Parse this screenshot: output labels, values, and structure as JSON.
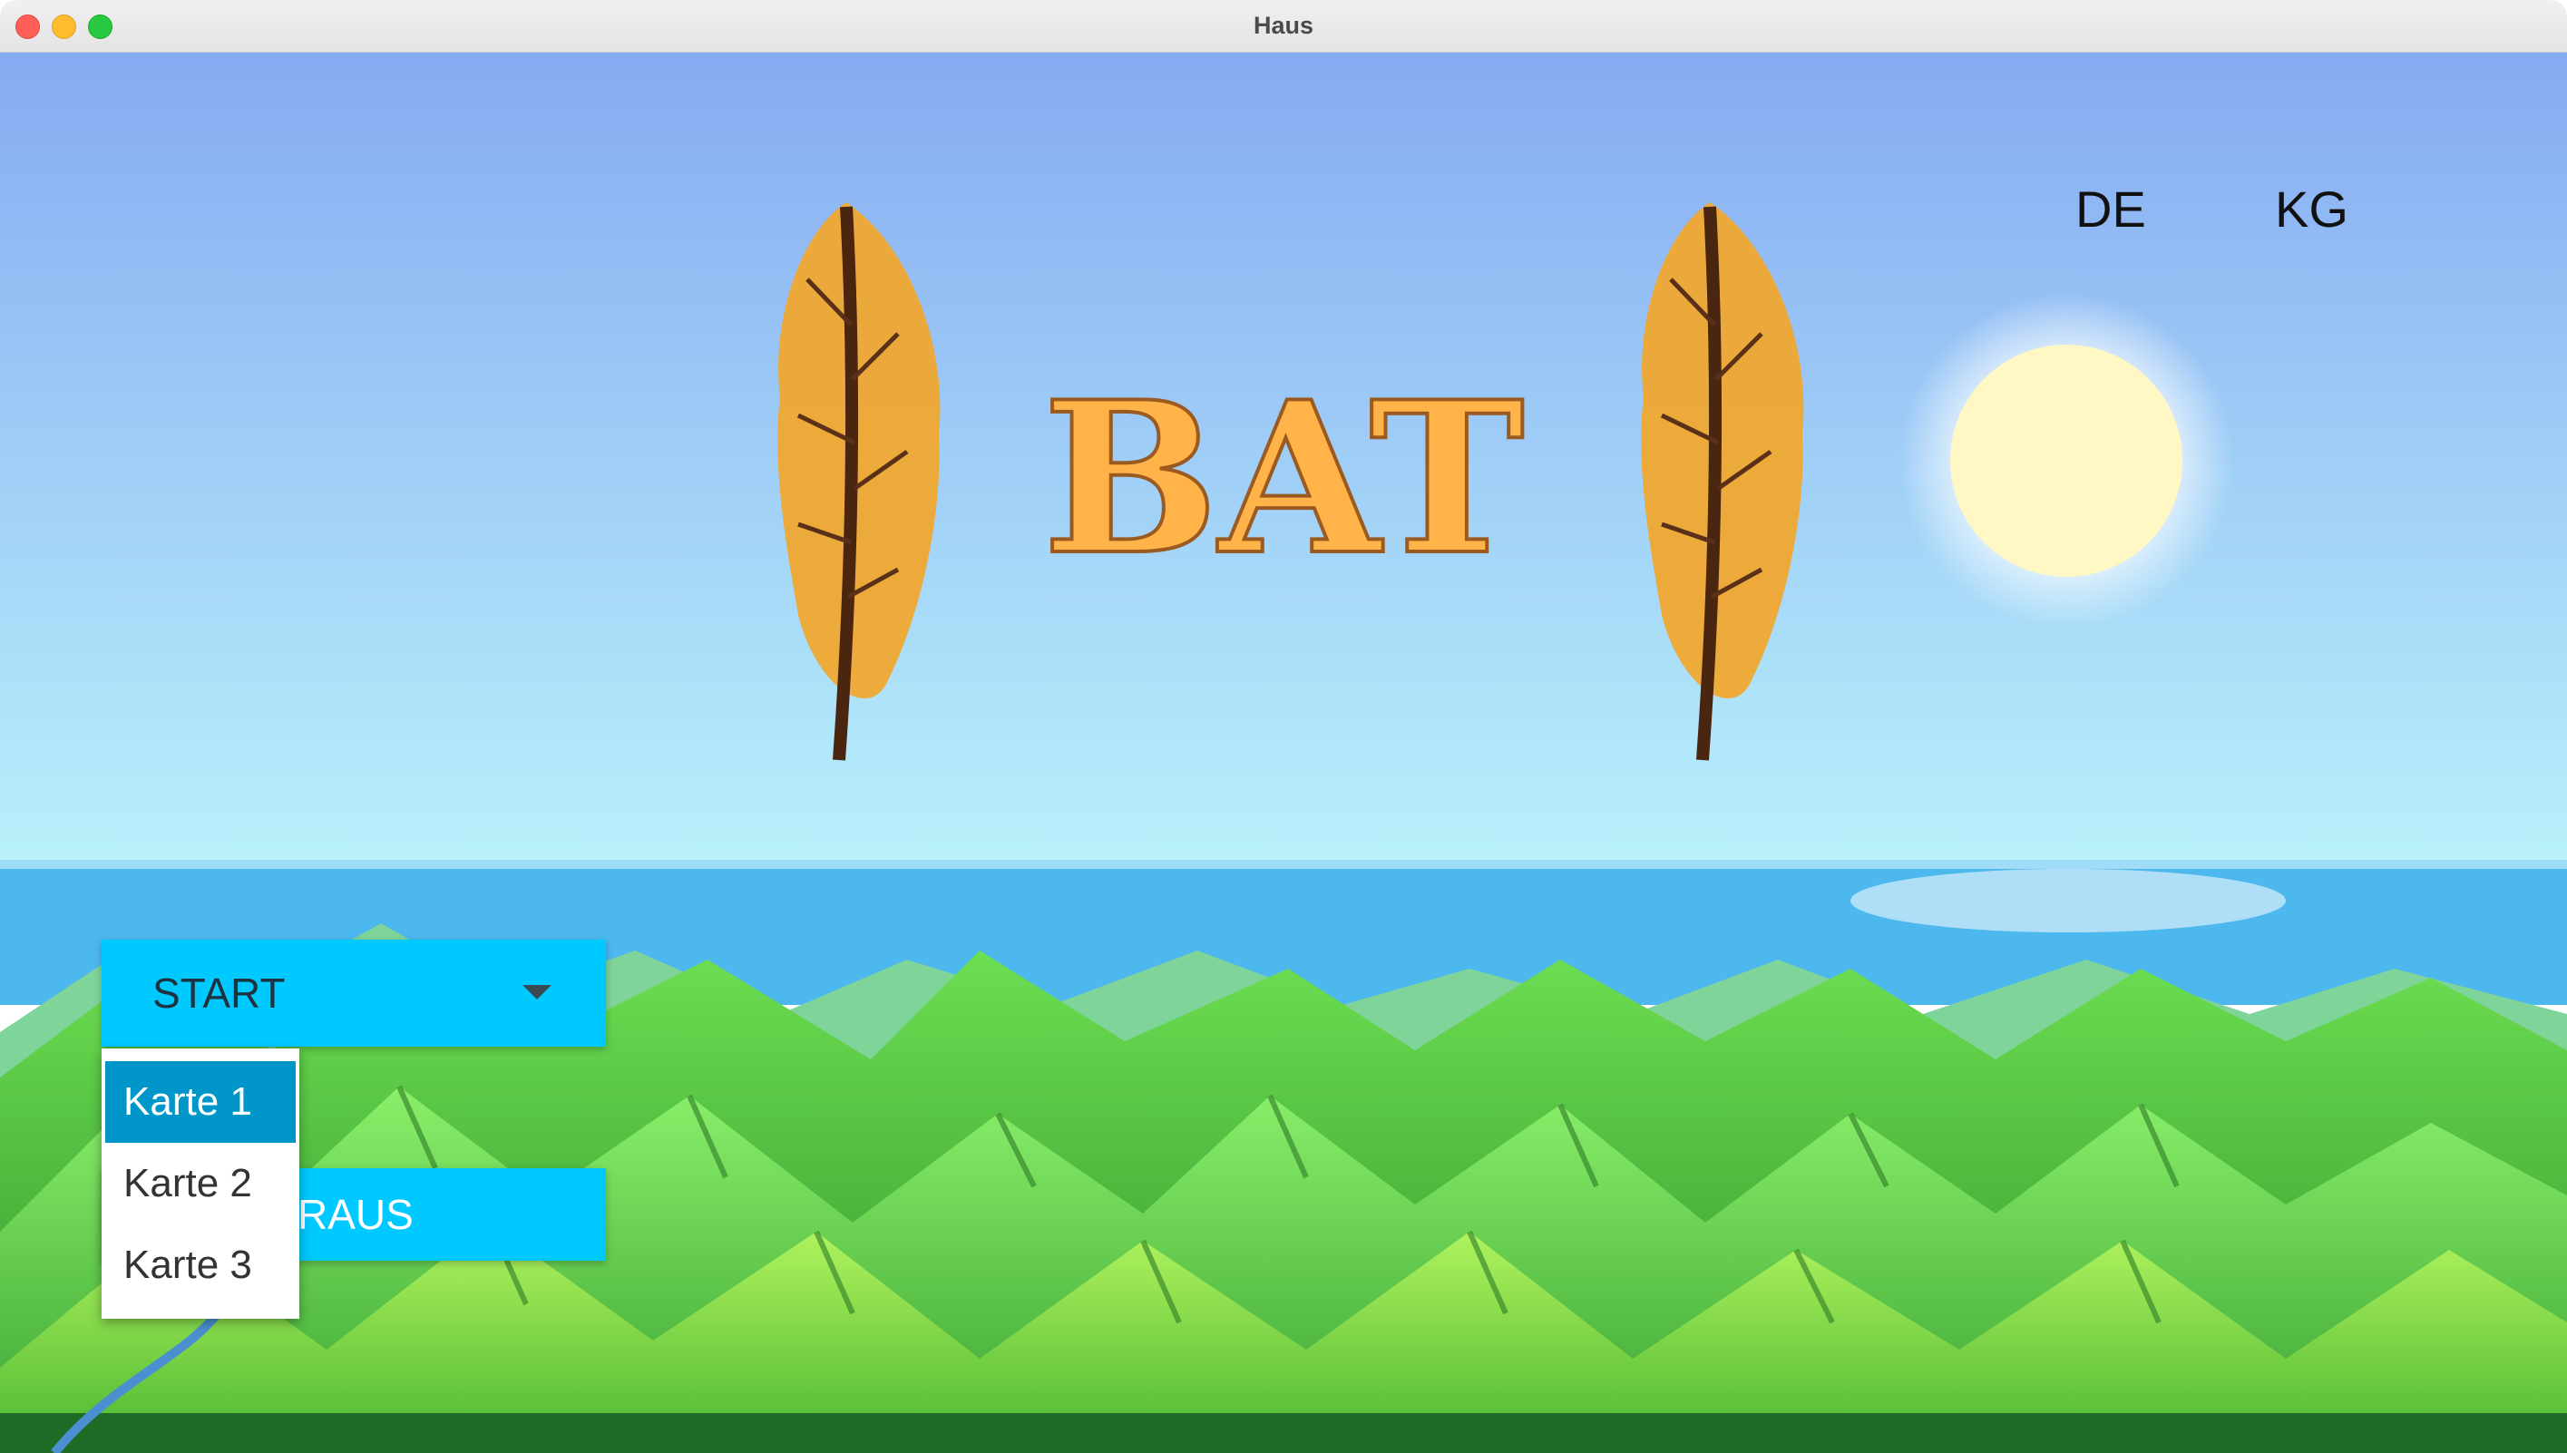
{
  "window": {
    "title": "Haus"
  },
  "header": {
    "logo_text": "BAT",
    "languages": [
      "DE",
      "KG"
    ]
  },
  "menu": {
    "start_select": {
      "selected_label": "START"
    },
    "dropdown": {
      "options": [
        "Karte 1",
        "Karte 2",
        "Karte 3"
      ],
      "highlighted": "Karte 1"
    },
    "raus_button": {
      "label": "RAUS"
    }
  },
  "icons": {
    "dropdown_arrow": "chevron-down-icon",
    "feather": "feather-icon",
    "sun": "sun-icon"
  },
  "colors": {
    "button": "#00c9ff",
    "dropdown_selected": "#0096c9",
    "logo_fill": "#ffb348",
    "logo_stroke": "#9a5a20",
    "sky_top": "#86aaf2",
    "sky_bottom": "#b8f2fb",
    "sea": "#4cb8ee"
  }
}
